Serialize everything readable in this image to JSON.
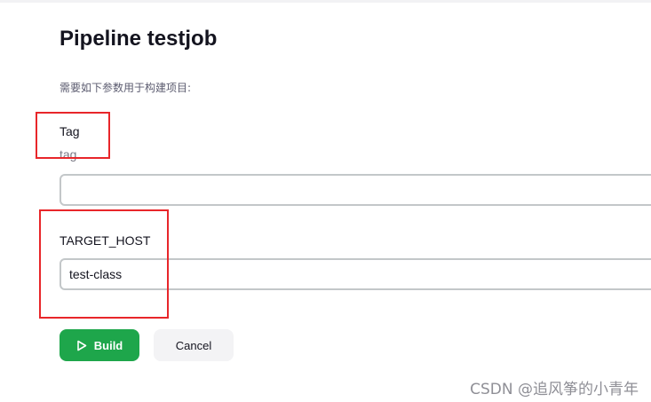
{
  "page": {
    "title": "Pipeline testjob",
    "description": "需要如下参数用于构建项目:"
  },
  "parameters": [
    {
      "name": "Tag",
      "description": "tag",
      "value": ""
    },
    {
      "name": "TARGET_HOST",
      "description": "",
      "value": "test-class"
    }
  ],
  "actions": {
    "build_label": "Build",
    "cancel_label": "Cancel"
  },
  "watermark": "CSDN @追风筝的小青年",
  "colors": {
    "build_button": "#1ea64b",
    "annotation_box": "#e8262a",
    "input_border": "#c3c7c9"
  },
  "icons": {
    "build": "play-icon"
  }
}
